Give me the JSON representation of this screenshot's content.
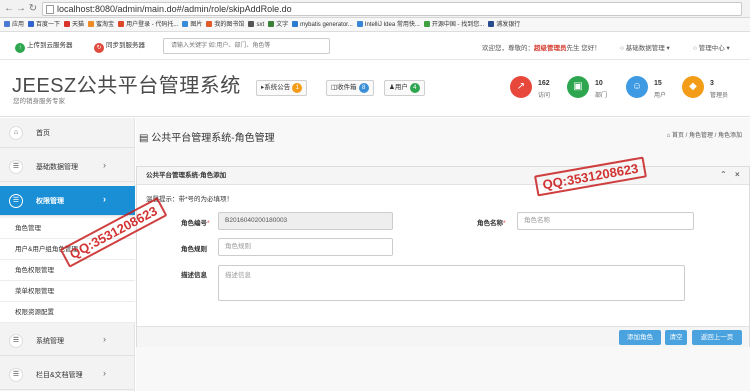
{
  "browser": {
    "url": "localhost:8080/admin/main.do#/admin/role/skipAddRole.do",
    "bookmarks": [
      {
        "label": "应用",
        "color": "#4a7bd0"
      },
      {
        "label": "百度一下",
        "color": "#2f64d1"
      },
      {
        "label": "天猫",
        "color": "#d9342b"
      },
      {
        "label": "蜜淘宝",
        "color": "#f08a24"
      },
      {
        "label": "用户登录 - 代码托...",
        "color": "#e0462b"
      },
      {
        "label": "图片",
        "color": "#3a8bd8"
      },
      {
        "label": "我的图书馆",
        "color": "#e05a2a"
      },
      {
        "label": "sxt",
        "color": "#555555"
      },
      {
        "label": "文字",
        "color": "#3b7f3b"
      },
      {
        "label": "mybatis generator...",
        "color": "#2d7bd0"
      },
      {
        "label": "IntelliJ Idea 常用快...",
        "color": "#3a86d6"
      },
      {
        "label": "开源中国 - 找到您...",
        "color": "#40a040"
      },
      {
        "label": "浦发银行",
        "color": "#2a4b8d"
      }
    ]
  },
  "topbar": {
    "upload_label": "上传到云服务器",
    "sync_label": "同步到服务器",
    "search_placeholder": "请输入关键字 如:用户、部门、角色等",
    "welcome_prefix": "欢迎您，尊敬的：",
    "welcome_role": "超级管理员",
    "welcome_suffix": "先生 您好！",
    "menu_basic": "基础数据管理",
    "menu_admin": "管理中心"
  },
  "header": {
    "title": "JEESZ公共平台管理系统",
    "slogan": "您的销身服务专家",
    "notice_label": "系统公告",
    "notice_count": "1",
    "mail_label": "收件箱",
    "mail_count": "8",
    "user_label": "用户",
    "user_count": "4",
    "stats": [
      {
        "num": "162",
        "label": "访问",
        "color": "#e8473c",
        "icon": "chart-icon"
      },
      {
        "num": "10",
        "label": "部门",
        "color": "#2ea650",
        "icon": "money-icon"
      },
      {
        "num": "15",
        "label": "用户",
        "color": "#3d9ae3",
        "icon": "user-icon"
      },
      {
        "num": "3",
        "label": "管理员",
        "color": "#f39c18",
        "icon": "dropbox-icon"
      }
    ]
  },
  "sidebar": {
    "home": "首页",
    "basic": "基础数据管理",
    "perm": "权限管理",
    "sub": [
      "角色管理",
      "用户&用户组角色管理",
      "角色权限管理",
      "菜单权限管理",
      "权限资源配置"
    ],
    "system": "系统管理",
    "column": "栏目&文档管理"
  },
  "main": {
    "page_title": "公共平台管理系统-角色管理",
    "breadcrumb": "首页 / 角色管理 / 角色添加",
    "panel_title": "公共平台管理系统-角色添加",
    "tip": "温馨提示：带*号的为必填项！",
    "role_code_label": "角色编号",
    "role_code_value": "B2016040200180003",
    "role_name_label": "角色名称",
    "role_name_placeholder": "角色名称",
    "role_rule_label": "角色规则",
    "role_rule_placeholder": "角色规则",
    "desc_label": "描述信息",
    "desc_placeholder": "描述信息",
    "btn_add": "添加角色",
    "btn_clear": "清空",
    "btn_back": "返回上一页"
  },
  "watermarks": [
    "QQ:3531208623",
    "QQ:3531208623"
  ]
}
